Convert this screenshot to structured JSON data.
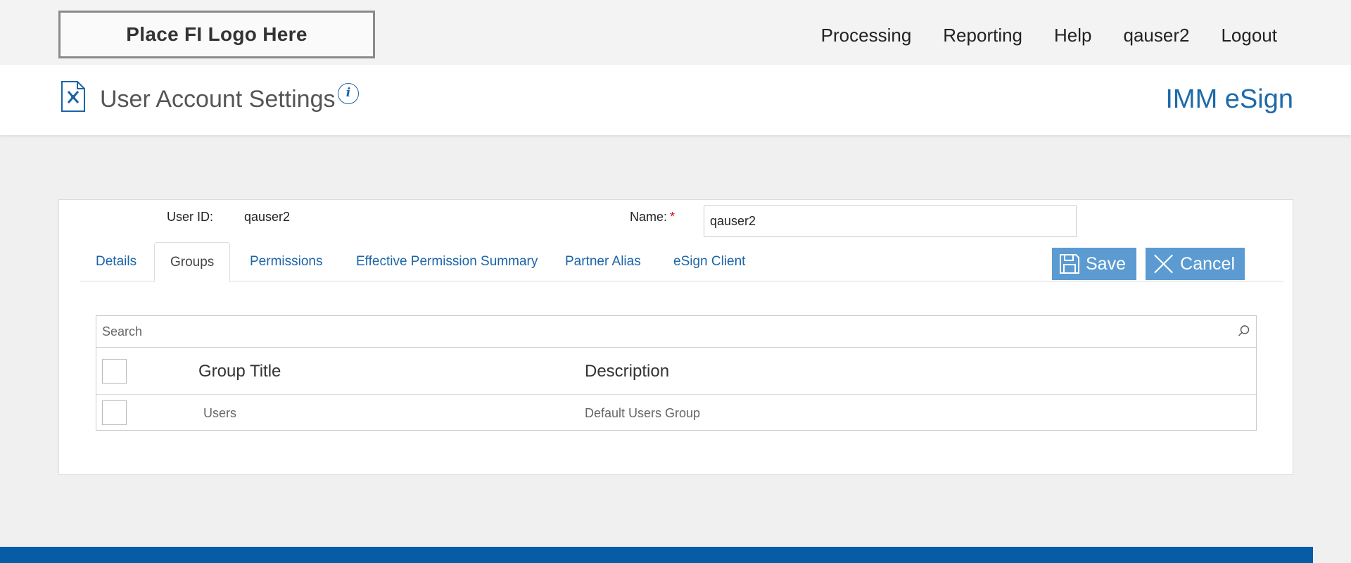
{
  "topbar": {
    "logo_text": "Place FI Logo Here",
    "nav": [
      "Processing",
      "Reporting",
      "Help",
      "qauser2",
      "Logout"
    ]
  },
  "header": {
    "title": "User Account Settings",
    "info_symbol": "i",
    "brand": "IMM eSign"
  },
  "form": {
    "user_id_label": "User ID:",
    "user_id_value": "qauser2",
    "name_label": "Name:",
    "required_mark": "*",
    "name_value": "qauser2"
  },
  "tabs": [
    {
      "label": "Details",
      "active": false
    },
    {
      "label": "Groups",
      "active": true
    },
    {
      "label": "Permissions",
      "active": false
    },
    {
      "label": "Effective Permission Summary",
      "active": false
    },
    {
      "label": "Partner Alias",
      "active": false
    },
    {
      "label": "eSign Client",
      "active": false
    }
  ],
  "actions": {
    "save_label": "Save",
    "cancel_label": "Cancel"
  },
  "search": {
    "placeholder": "Search"
  },
  "table": {
    "columns": [
      "Group Title",
      "Description"
    ],
    "rows": [
      {
        "title": "Users",
        "description": "Default Users Group",
        "checked": false
      }
    ]
  },
  "colors": {
    "accent": "#1a64a8",
    "button": "#5b9bd1",
    "footer": "#075ca6",
    "required": "#dd1111"
  }
}
